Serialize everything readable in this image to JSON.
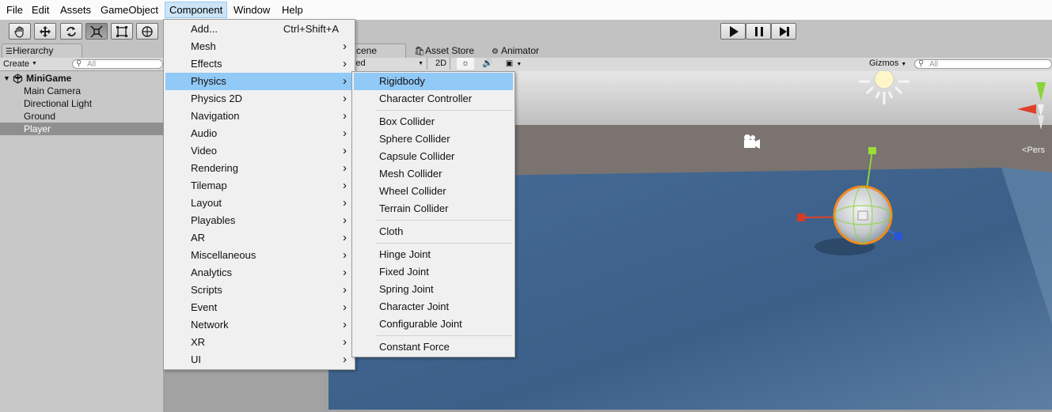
{
  "menubar": {
    "items": [
      "File",
      "Edit",
      "Assets",
      "GameObject",
      "Component",
      "Window",
      "Help"
    ]
  },
  "toolbar": {
    "tools": [
      "hand-icon",
      "move-icon",
      "rotate-icon",
      "scale-icon",
      "rect-tool-icon",
      "transform-icon"
    ],
    "play": [
      "play-icon",
      "pause-icon",
      "step-icon"
    ]
  },
  "hierarchy": {
    "tab": "Hierarchy",
    "create": "Create",
    "search_placeholder": "All",
    "scene": "MiniGame",
    "items": [
      "Main Camera",
      "Directional Light",
      "Ground",
      "Player"
    ],
    "selected": "Player"
  },
  "scene_view": {
    "tabs": [
      "cene",
      "Asset Store",
      "Animator"
    ],
    "shading": "led",
    "mode_2d": "2D",
    "gizmos": "Gizmos",
    "search_placeholder": "All",
    "persp_label": "Pers"
  },
  "component_menu": {
    "items": [
      {
        "label": "Add...",
        "shortcut": "Ctrl+Shift+A",
        "submenu": false
      },
      {
        "label": "Mesh",
        "submenu": true
      },
      {
        "label": "Effects",
        "submenu": true
      },
      {
        "label": "Physics",
        "submenu": true
      },
      {
        "label": "Physics 2D",
        "submenu": true
      },
      {
        "label": "Navigation",
        "submenu": true
      },
      {
        "label": "Audio",
        "submenu": true
      },
      {
        "label": "Video",
        "submenu": true
      },
      {
        "label": "Rendering",
        "submenu": true
      },
      {
        "label": "Tilemap",
        "submenu": true
      },
      {
        "label": "Layout",
        "submenu": true
      },
      {
        "label": "Playables",
        "submenu": true
      },
      {
        "label": "AR",
        "submenu": true
      },
      {
        "label": "Miscellaneous",
        "submenu": true
      },
      {
        "label": "Analytics",
        "submenu": true
      },
      {
        "label": "Scripts",
        "submenu": true
      },
      {
        "label": "Event",
        "submenu": true
      },
      {
        "label": "Network",
        "submenu": true
      },
      {
        "label": "XR",
        "submenu": true
      },
      {
        "label": "UI",
        "submenu": true
      }
    ],
    "highlighted": "Physics"
  },
  "physics_submenu": {
    "groups": [
      [
        "Rigidbody",
        "Character Controller"
      ],
      [
        "Box Collider",
        "Sphere Collider",
        "Capsule Collider",
        "Mesh Collider",
        "Wheel Collider",
        "Terrain Collider"
      ],
      [
        "Cloth"
      ],
      [
        "Hinge Joint",
        "Fixed Joint",
        "Spring Joint",
        "Character Joint",
        "Configurable Joint"
      ],
      [
        "Constant Force"
      ]
    ],
    "highlighted": "Rigidbody"
  },
  "colors": {
    "menu_highlight": "#91c9f7",
    "menubar_active": "#cce4f7",
    "selection_ring": "#f28a1c",
    "sky": "#c9c9c9",
    "ground": "#3d648f"
  }
}
